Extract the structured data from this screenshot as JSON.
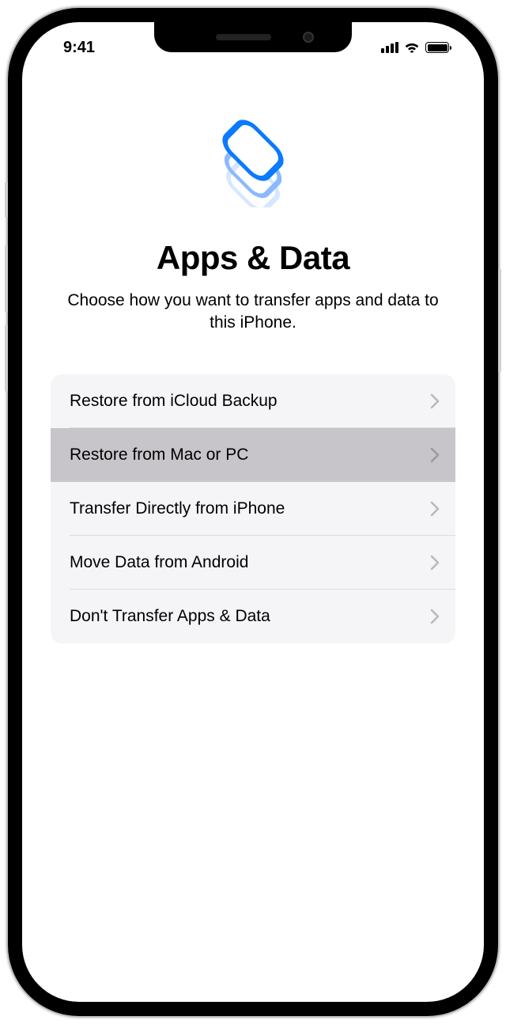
{
  "status": {
    "time": "9:41"
  },
  "header": {
    "title": "Apps & Data",
    "subtitle": "Choose how you want to transfer apps and data to this iPhone."
  },
  "options": [
    {
      "label": "Restore from iCloud Backup",
      "highlighted": false
    },
    {
      "label": "Restore from Mac or PC",
      "highlighted": true
    },
    {
      "label": "Transfer Directly from iPhone",
      "highlighted": false
    },
    {
      "label": "Move Data from Android",
      "highlighted": false
    },
    {
      "label": "Don't Transfer Apps & Data",
      "highlighted": false
    }
  ]
}
